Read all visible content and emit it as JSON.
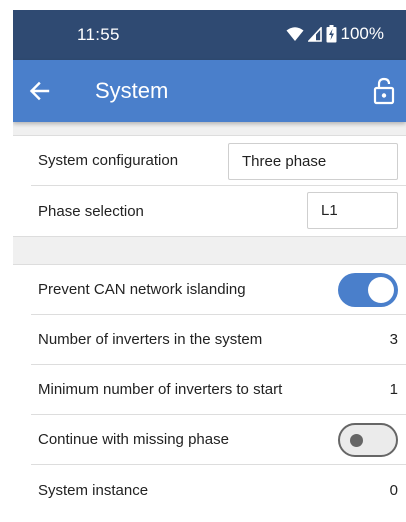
{
  "status_bar": {
    "time": "11:55",
    "battery": "100%",
    "icons": [
      "wifi-icon",
      "cellular-signal-icon",
      "battery-icon"
    ]
  },
  "app_bar": {
    "title": "System",
    "back_icon": "arrow-left-icon",
    "lock_icon": "lock-open-icon",
    "color": "#4a7fcb"
  },
  "settings": {
    "system_configuration": {
      "label": "System configuration",
      "value": "Three phase"
    },
    "phase_selection": {
      "label": "Phase selection",
      "value": "L1"
    },
    "prevent_can_islanding": {
      "label": "Prevent CAN network islanding",
      "enabled": true
    },
    "number_of_inverters": {
      "label": "Number of inverters in the system",
      "value": "3"
    },
    "min_inverters_to_start": {
      "label": "Minimum number of inverters to start",
      "value": "1"
    },
    "continue_missing_phase": {
      "label": "Continue with missing phase",
      "enabled": false
    },
    "system_instance": {
      "label": "System instance",
      "value": "0"
    }
  }
}
